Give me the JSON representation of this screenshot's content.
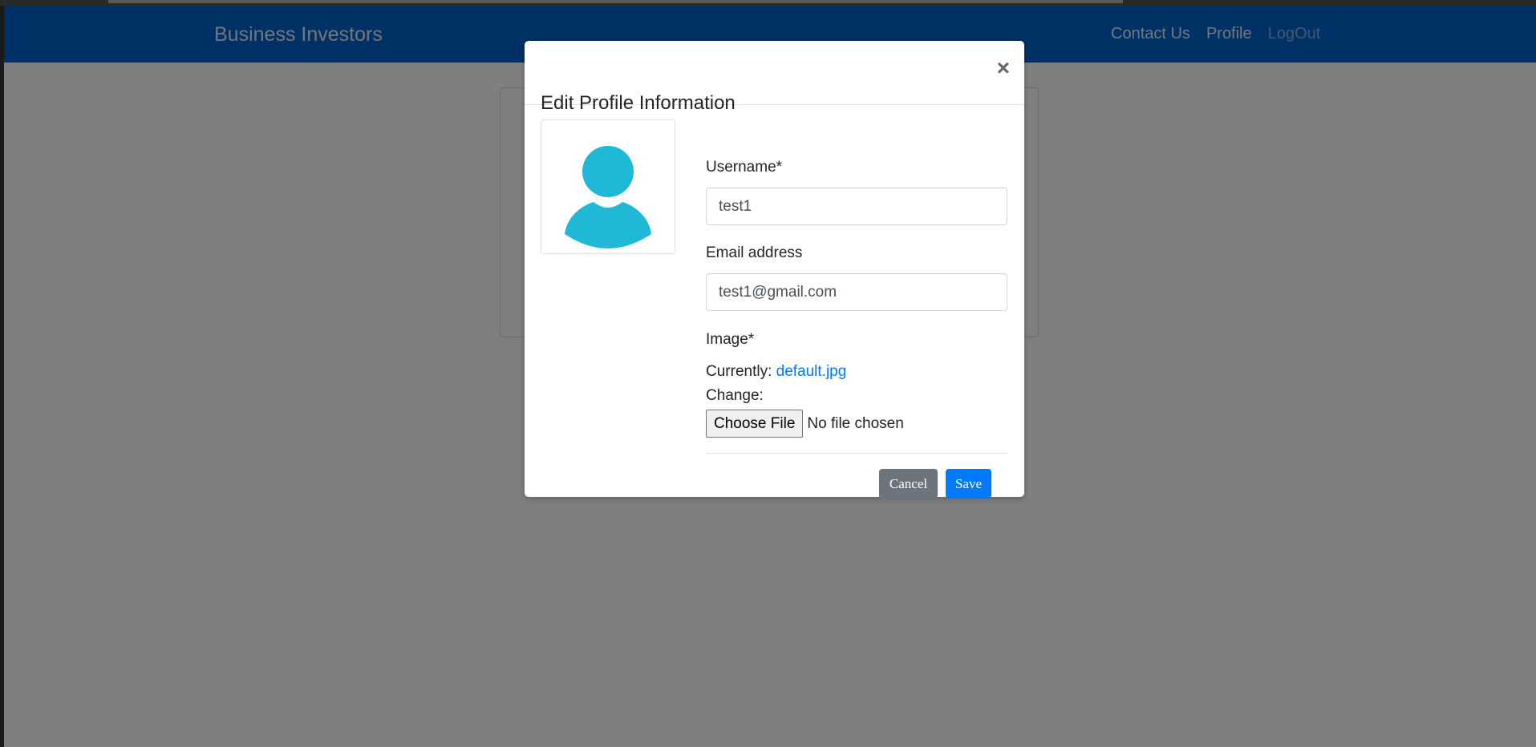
{
  "navbar": {
    "brand": "Business Investors",
    "links": [
      "Contact Us",
      "Profile",
      "LogOut"
    ]
  },
  "modal": {
    "title": "Edit Profile Information",
    "close_glyph": "×",
    "avatar_icon": "user-avatar-icon",
    "avatar_color": "#1fb8d6",
    "username_label": "Username*",
    "username_value": "test1",
    "email_label": "Email address",
    "email_value": "test1@gmail.com",
    "image_label": "Image*",
    "currently_label": "Currently:",
    "current_file": "default.jpg",
    "change_label": "Change:",
    "choose_file_label": "Choose File",
    "no_file_text": "No file chosen",
    "cancel_label": "Cancel",
    "save_label": "Save"
  },
  "colors": {
    "navbar": "#0062cc",
    "primary": "#007bff",
    "secondary": "#6c757d",
    "backdrop": "rgba(0,0,0,0.5)"
  }
}
